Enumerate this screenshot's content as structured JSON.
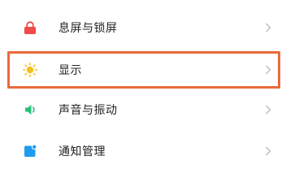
{
  "settings": {
    "items": [
      {
        "label": "息屏与锁屏",
        "icon": "lock-icon",
        "icon_color": "#ef4b4b"
      },
      {
        "label": "显示",
        "icon": "sun-icon",
        "icon_color": "#f2c21b"
      },
      {
        "label": "声音与振动",
        "icon": "speaker-icon",
        "icon_color": "#28c27a"
      },
      {
        "label": "通知管理",
        "icon": "notification-icon",
        "icon_color": "#1f9cf0"
      }
    ],
    "highlight_color": "#ea6a3a",
    "chevron_color": "#b9b9b9"
  }
}
